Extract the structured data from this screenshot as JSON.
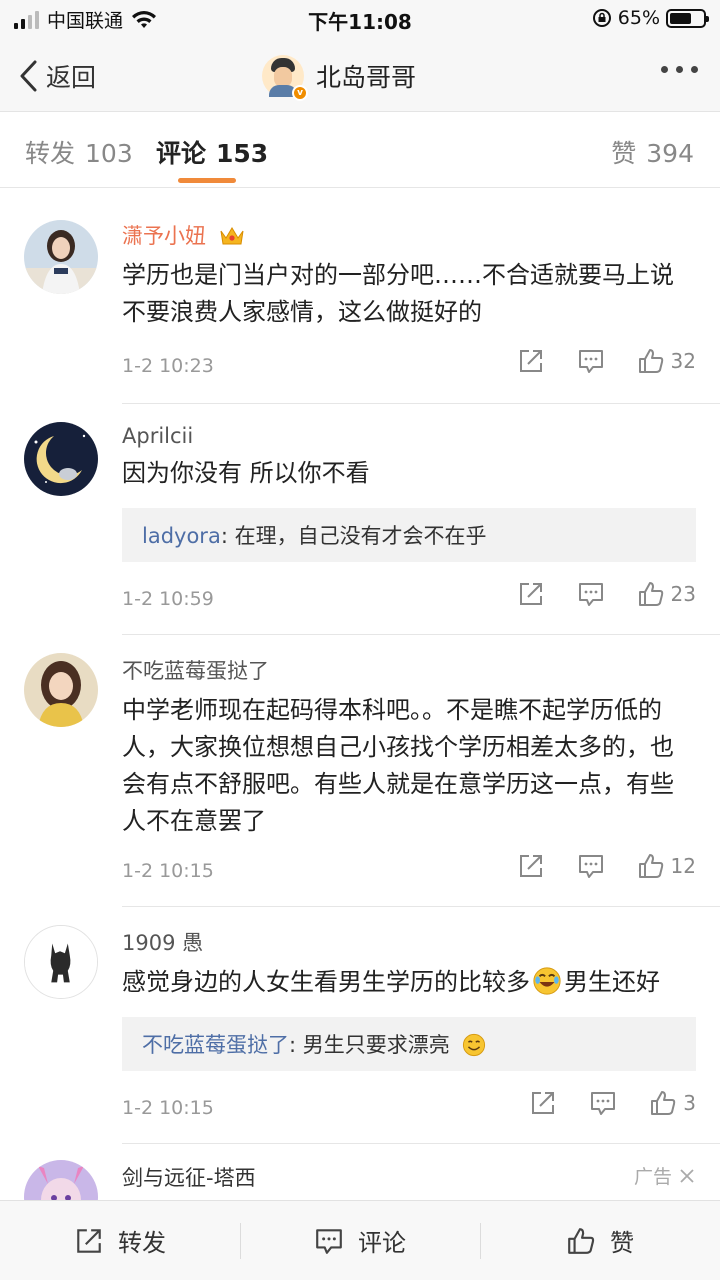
{
  "status_bar": {
    "carrier": "中国联通",
    "time": "下午11:08",
    "battery": "65%",
    "battery_level": 0.65
  },
  "nav": {
    "back_label": "返回",
    "title": "北岛哥哥",
    "verified_badge": "v"
  },
  "tabs": {
    "repost_label": "转发",
    "repost_count": "103",
    "comment_label": "评论",
    "comment_count": "153",
    "like_label": "赞",
    "like_count": "394",
    "active_color": "#f08a3a"
  },
  "comments": [
    {
      "name": "潇予小妞",
      "vip": true,
      "text": "学历也是门当户对的一部分吧……不合适就要马上说不要浪费人家感情，这么做挺好的",
      "time": "1-2 10:23",
      "likes": "32"
    },
    {
      "name": "Aprilcii",
      "vip": false,
      "text": "因为你没有 所以你不看",
      "reply_user": "ladyora",
      "reply_text": ": 在理，自己没有才会不在乎",
      "time": "1-2 10:59",
      "likes": "23"
    },
    {
      "name": "不吃蓝莓蛋挞了",
      "vip": false,
      "text": "中学老师现在起码得本科吧。。不是瞧不起学历低的人，大家换位想想自己小孩找个学历相差太多的，也会有点不舒服吧。有些人就是在意学历这一点，有些人不在意罢了",
      "time": "1-2 10:15",
      "likes": "12"
    },
    {
      "name": "1909 愚",
      "vip": false,
      "text_a": "感觉身边的人女生看男生学历的比较多",
      "text_b": "男生还好",
      "reply_user": "不吃蓝莓蛋挞了",
      "reply_text": ": 男生只要求漂亮",
      "time": "1-2 10:15",
      "likes": "3"
    },
    {
      "name": "剑与远征-塔西",
      "ad_label": "广告"
    }
  ],
  "bottom_bar": {
    "repost_label": "转发",
    "comment_label": "评论",
    "like_label": "赞"
  },
  "colors": {
    "vip_name": "#eb7350",
    "reply_user": "#4e6ea6",
    "accent": "#f08a3a"
  }
}
